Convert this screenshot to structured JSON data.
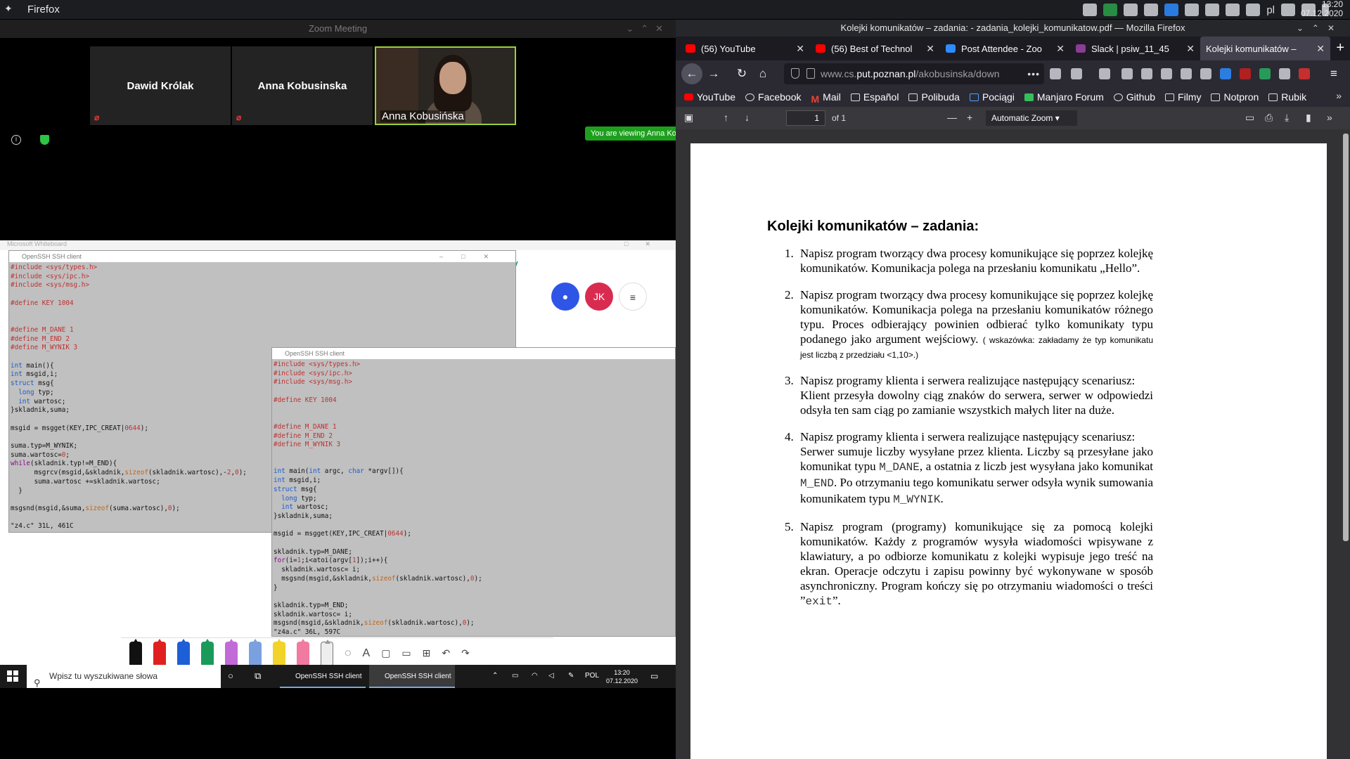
{
  "topbar": {
    "app_name": "Firefox",
    "lang": "pl",
    "time": "13:20",
    "date": "07.12.2020"
  },
  "zoom": {
    "window_title": "Zoom Meeting",
    "participants": [
      {
        "name": "Dawid Królak"
      },
      {
        "name": "Anna Kobusinska"
      },
      {
        "name": "Anna Kobusińska"
      }
    ],
    "viewing_notice": "You are viewing Anna Ko"
  },
  "share": {
    "whiteboard_title": "Microsoft Whiteboard",
    "ssh_title_1": "OpenSSH SSH client",
    "ssh_title_2": "OpenSSH SSH client",
    "avatar_initials": "JK",
    "taskbar": {
      "search_placeholder": "Wpisz tu wyszukiwane słowa",
      "task_1": "OpenSSH SSH client",
      "task_2": "OpenSSH SSH client",
      "lang": "POL",
      "time": "13:20",
      "date": "07.12.2020"
    }
  },
  "firefox": {
    "window_title": "Kolejki komunikatów – zadania: - zadania_kolejki_komunikatow.pdf — Mozilla Firefox",
    "tabs": [
      {
        "label": "(56) YouTube",
        "color": "#ff0000"
      },
      {
        "label": "(56) Best of Technol",
        "color": "#ff0000"
      },
      {
        "label": "Post Attendee - Zoo",
        "color": "#2d8cff"
      },
      {
        "label": "Slack | psiw_11_45",
        "color": "#611f69"
      },
      {
        "label": "Kolejki komunikatów –",
        "color": "#42414d"
      }
    ],
    "url_prefix": "www.cs.",
    "url_domain": "put.poznan.pl",
    "url_rest": "/akobusinska/down",
    "bookmarks": [
      "YouTube",
      "Facebook",
      "Mail",
      "Español",
      "Polibuda",
      "Pociągi",
      "Manjaro Forum",
      "Github",
      "Filmy",
      "Notpron",
      "Rubik"
    ],
    "pdf": {
      "page_num": "1",
      "page_of": "of 1",
      "zoom": "Automatic Zoom",
      "title": "Kolejki komunikatów – zadania:",
      "items": [
        {
          "num": "1.",
          "text": "Napisz program tworzący dwa procesy komunikujące się poprzez kolejkę komunikatów. Komunikacja polega na przesłaniu komunikatu „Hello”."
        },
        {
          "num": "2.",
          "text": "Napisz program tworzący dwa procesy komunikujące się poprzez kolejkę komunikatów. Komunikacja polega na przesłaniu komunikatów różnego typu. Proces odbierający powinien odbierać tylko komunikaty typu podanego jako argument wejściowy.",
          "hint": "( wskazówka: zakładamy że typ komunikatu jest liczbą z przedziału <1,10>.)"
        },
        {
          "num": "3.",
          "text": "Napisz programy klienta i serwera realizujące następujący scenariusz:",
          "text2": "Klient przesyła dowolny ciąg znaków do serwera, serwer w odpowiedzi odsyła ten sam ciąg po zamianie wszystkich małych liter na duże."
        },
        {
          "num": "4.",
          "text": "Napisz programy klienta i serwera realizujące następujący scenariusz:",
          "text2a": "Serwer sumuje liczby wysyłane przez klienta. Liczby są przesyłane jako komunikat typu",
          "c1": "M_DANE",
          "text2b": ", a ostatnia z liczb jest wysyłana jako komunikat",
          "c2": "M_END",
          "text2c": ". Po otrzymaniu tego komunikatu serwer odsyła wynik sumowania komunikatem typu",
          "c3": "M_WYNIK",
          "text2d": "."
        },
        {
          "num": "5.",
          "text": "Napisz program (programy) komunikujące się za pomocą kolejki komunikatów. Każdy z programów wysyła wiadomości wpisywane z klawiatury, a po odbiorze komunikatu z kolejki wypisuje jego treść na ekran. Operacje odczytu i zapisu powinny być wykonywane w sposób asynchroniczny. Program kończy się po otrzymaniu wiadomości o treści ”",
          "c1": "exit",
          "text2": "”."
        }
      ]
    }
  }
}
